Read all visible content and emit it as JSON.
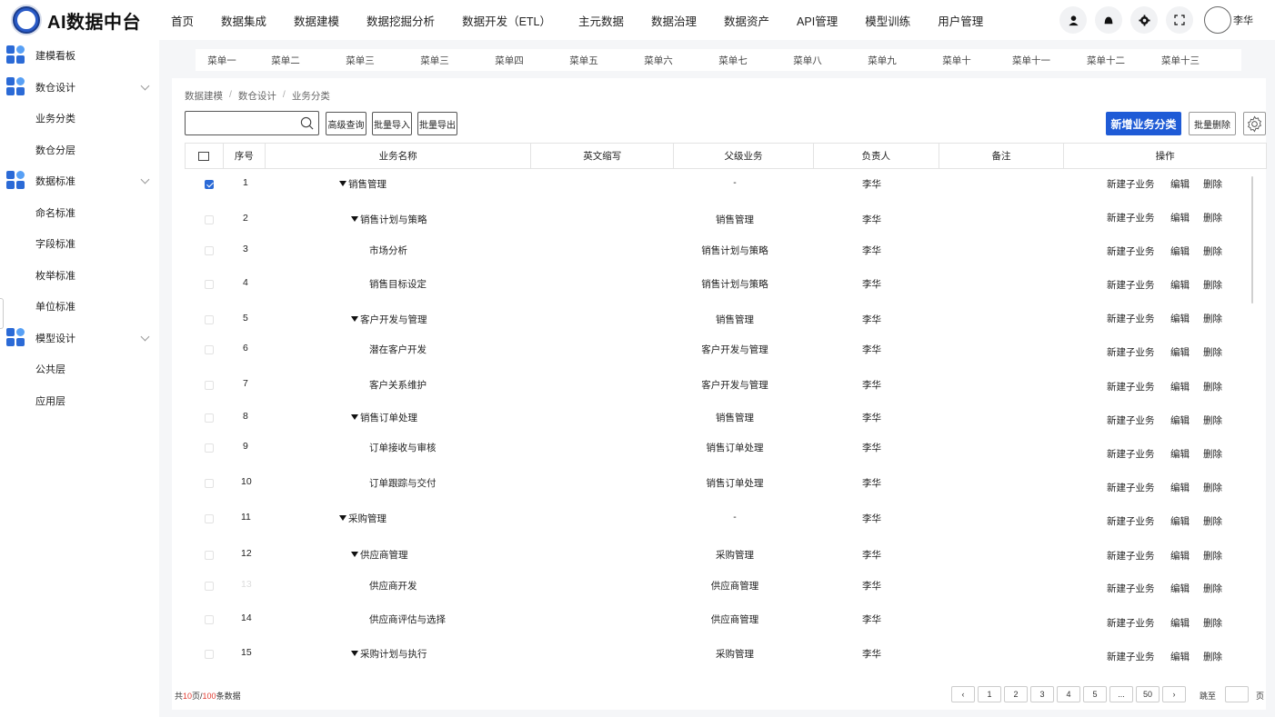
{
  "app": {
    "title": "AI数据中台"
  },
  "topnav": [
    "首页",
    "数据集成",
    "数据建模",
    "数据挖掘分析",
    "数据开发（ETL）",
    "主元数据",
    "数据治理",
    "数据资产",
    "API管理",
    "模型训练",
    "用户管理"
  ],
  "user": {
    "name": "李华"
  },
  "sidebar": {
    "items": [
      {
        "type": "group",
        "label": "建模看板",
        "expandable": false
      },
      {
        "type": "group",
        "label": "数仓设计",
        "expandable": true
      },
      {
        "type": "sub",
        "label": "业务分类"
      },
      {
        "type": "sub",
        "label": "数仓分层"
      },
      {
        "type": "group",
        "label": "数据标准",
        "expandable": true
      },
      {
        "type": "sub",
        "label": "命名标准"
      },
      {
        "type": "sub",
        "label": "字段标准"
      },
      {
        "type": "sub",
        "label": "枚举标准"
      },
      {
        "type": "sub",
        "label": "单位标准"
      },
      {
        "type": "group",
        "label": "模型设计",
        "expandable": true
      },
      {
        "type": "sub",
        "label": "公共层"
      },
      {
        "type": "sub",
        "label": "应用层"
      }
    ]
  },
  "menubar": [
    "菜单一",
    "菜单二",
    "菜单三",
    "菜单三",
    "菜单四",
    "菜单五",
    "菜单六",
    "菜单七",
    "菜单八",
    "菜单九",
    "菜单十",
    "菜单十一",
    "菜单十二",
    "菜单十三"
  ],
  "breadcrumb": [
    "数据建模",
    "数仓设计",
    "业务分类"
  ],
  "toolbar": {
    "search_placeholder": "",
    "advanced_query": "高级查询",
    "batch_import": "批量导入",
    "batch_export": "批量导出",
    "add_category": "新增业务分类",
    "batch_delete": "批量删除"
  },
  "table": {
    "headers": [
      "",
      "序号",
      "业务名称",
      "英文缩写",
      "父级业务",
      "负责人",
      "备注",
      "操作"
    ],
    "actions": [
      "新建子业务",
      "编辑",
      "删除"
    ],
    "rows": [
      {
        "no": "1",
        "name": "销售管理",
        "level": 0,
        "expanded": true,
        "parent": "-",
        "owner": "李华",
        "checked": true
      },
      {
        "no": "2",
        "name": "销售计划与策略",
        "level": 1,
        "expanded": true,
        "parent": "销售管理",
        "owner": "李华",
        "checked": false
      },
      {
        "no": "3",
        "name": "市场分析",
        "level": 2,
        "expanded": false,
        "parent": "销售计划与策略",
        "owner": "李华",
        "checked": false
      },
      {
        "no": "4",
        "name": "销售目标设定",
        "level": 2,
        "expanded": false,
        "parent": "销售计划与策略",
        "owner": "李华",
        "checked": false
      },
      {
        "no": "5",
        "name": "客户开发与管理",
        "level": 1,
        "expanded": true,
        "parent": "销售管理",
        "owner": "李华",
        "checked": false
      },
      {
        "no": "6",
        "name": "潜在客户开发",
        "level": 2,
        "expanded": false,
        "parent": "客户开发与管理",
        "owner": "李华",
        "checked": false
      },
      {
        "no": "7",
        "name": "客户关系维护",
        "level": 2,
        "expanded": false,
        "parent": "客户开发与管理",
        "owner": "李华",
        "checked": false
      },
      {
        "no": "8",
        "name": "销售订单处理",
        "level": 1,
        "expanded": true,
        "parent": "销售管理",
        "owner": "李华",
        "checked": false
      },
      {
        "no": "9",
        "name": "订单接收与审核",
        "level": 2,
        "expanded": false,
        "parent": "销售订单处理",
        "owner": "李华",
        "checked": false
      },
      {
        "no": "10",
        "name": "订单跟踪与交付",
        "level": 2,
        "expanded": false,
        "parent": "销售订单处理",
        "owner": "李华",
        "checked": false
      },
      {
        "no": "11",
        "name": "采购管理",
        "level": 0,
        "expanded": true,
        "parent": "-",
        "owner": "李华",
        "checked": false
      },
      {
        "no": "12",
        "name": "供应商管理",
        "level": 1,
        "expanded": true,
        "parent": "采购管理",
        "owner": "李华",
        "checked": false
      },
      {
        "no": "13",
        "name": "供应商开发",
        "level": 2,
        "expanded": false,
        "parent": "供应商管理",
        "owner": "李华",
        "checked": false
      },
      {
        "no": "14",
        "name": "供应商评估与选择",
        "level": 2,
        "expanded": false,
        "parent": "供应商管理",
        "owner": "李华",
        "checked": false
      },
      {
        "no": "15",
        "name": "采购计划与执行",
        "level": 1,
        "expanded": true,
        "parent": "采购管理",
        "owner": "李华",
        "checked": false
      }
    ]
  },
  "footer": {
    "total_prefix": "共",
    "total_pages": "10",
    "pages_sep": "页/",
    "total_records": "100",
    "records_suffix": "条数据",
    "pages": [
      "‹",
      "1",
      "2",
      "3",
      "4",
      "5",
      "...",
      "50",
      "›"
    ],
    "jump_label": "跳至",
    "page_unit": "页"
  },
  "colors": {
    "primary": "#1f5bd6",
    "accent_red": "#e03a2f"
  }
}
